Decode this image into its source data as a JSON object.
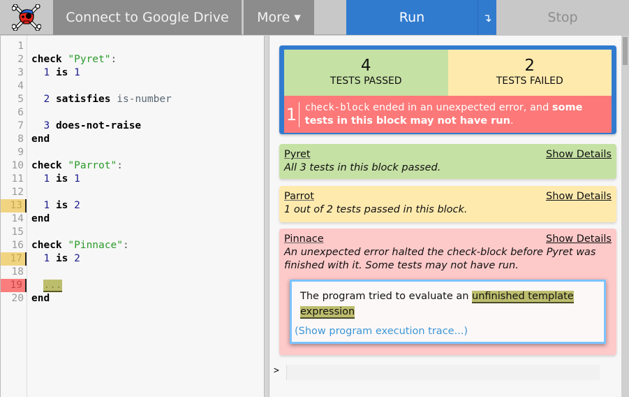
{
  "header": {
    "logo_icon": "pyret-skull-crossbones-logo",
    "connect_label": "Connect to Google Drive",
    "more_label": "More ▾",
    "run_label": "Run",
    "run_options_icon": "↴",
    "stop_label": "Stop"
  },
  "editor": {
    "line_numbers": [
      "1",
      "2",
      "3",
      "4",
      "5",
      "6",
      "7",
      "8",
      "9",
      "10",
      "11",
      "12",
      "13",
      "14",
      "15",
      "16",
      "17",
      "18",
      "19",
      "20"
    ],
    "highlights": {
      "warning_lines": [
        13,
        17
      ],
      "error_lines": [
        19
      ]
    },
    "lines": [
      "",
      "check \"Pyret\":",
      "  1 is 1",
      "",
      "  2 satisfies is-number",
      "",
      "  3 does-not-raise",
      "end",
      "",
      "check \"Parrot\":",
      "  1 is 1",
      "",
      "  1 is 2",
      "end",
      "",
      "check \"Pinnace\":",
      "  1 is 2",
      "",
      "  ...",
      "end"
    ],
    "tokens": {
      "check": "check",
      "end": "end",
      "is": "is",
      "satisfies": "satisfies",
      "does_not_raise": "does-not-raise",
      "is_number": "is-number",
      "colon": ":",
      "str_pyret": "\"Pyret\"",
      "str_parrot": "\"Parrot\"",
      "str_pinnace": "\"Pinnace\"",
      "n1": "1",
      "n2": "2",
      "n3": "3",
      "template": "..."
    }
  },
  "summary": {
    "passed_count": "4",
    "passed_label": "TESTS PASSED",
    "failed_count": "2",
    "failed_label": "TESTS FAILED",
    "error_count": "1",
    "error_code": "check-block",
    "error_text": " ended in an unexpected error, and ",
    "error_bold": "some tests in this block may not have run",
    "error_end": "."
  },
  "blocks": [
    {
      "name": "Pyret",
      "show_label": "Show Details",
      "message": "All 3 tests in this block passed.",
      "status": "passed"
    },
    {
      "name": "Parrot",
      "show_label": "Show Details",
      "message": "1 out of 2 tests passed in this block.",
      "status": "failed"
    },
    {
      "name": "Pinnace",
      "show_label": "Show Details",
      "message": "An unexpected error halted the check-block before Pyret was finished with it. Some tests may not have run.",
      "status": "error"
    }
  ],
  "error_detail": {
    "text": "The program tried to evaluate an ",
    "highlight": "unfinished template expression",
    "trace_link": "(Show program execution trace...)"
  },
  "repl": {
    "prompt": ">",
    "input_value": ""
  },
  "colors": {
    "run_blue": "#317bcf",
    "passed_green": "#c5e1a4",
    "failed_yellow": "#ffeaae",
    "error_red": "#fd7979",
    "error_block_pink": "#fec9c9"
  }
}
